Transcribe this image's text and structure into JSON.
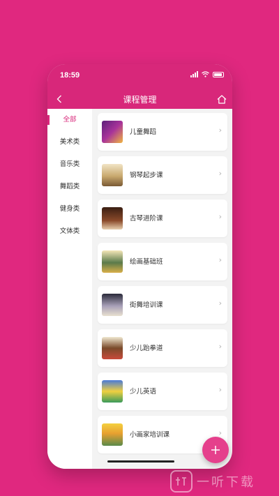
{
  "status_bar": {
    "time": "18:59"
  },
  "nav": {
    "title": "课程管理",
    "back_icon": "chevron-left-icon",
    "home_icon": "home-icon"
  },
  "sidebar": {
    "items": [
      {
        "label": "全部",
        "active": true
      },
      {
        "label": "美术类",
        "active": false
      },
      {
        "label": "音乐类",
        "active": false
      },
      {
        "label": "舞蹈类",
        "active": false
      },
      {
        "label": "健身类",
        "active": false
      },
      {
        "label": "文体类",
        "active": false
      }
    ]
  },
  "courses": [
    {
      "label": "儿童舞蹈"
    },
    {
      "label": "钢琴起步课"
    },
    {
      "label": "古琴进阶课"
    },
    {
      "label": "绘画基础班"
    },
    {
      "label": "街舞培训课"
    },
    {
      "label": "少儿跆拳道"
    },
    {
      "label": "少儿英语"
    },
    {
      "label": "小画家培训课"
    }
  ],
  "fab": {
    "icon": "plus-icon"
  },
  "watermark": {
    "text": "一听下载",
    "icon": "listen-logo-icon"
  },
  "colors": {
    "brand": "#d8277a",
    "background": "#e0287f",
    "fab": "#e5408c"
  }
}
